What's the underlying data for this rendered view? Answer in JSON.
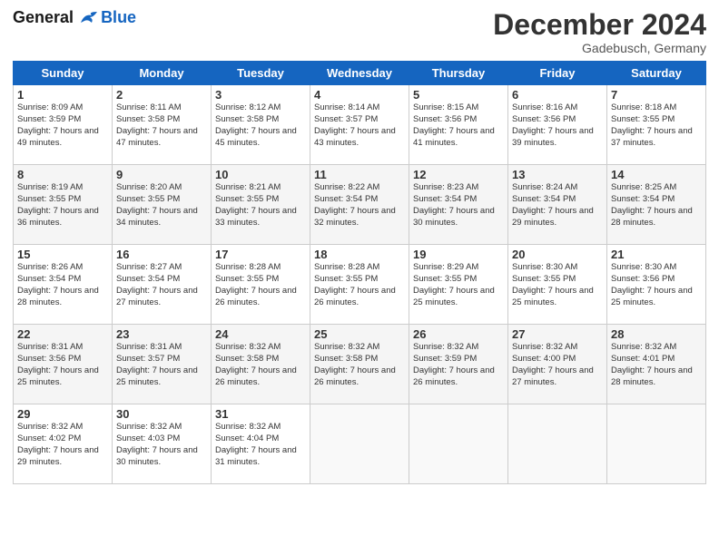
{
  "header": {
    "logo_line1": "General",
    "logo_line2": "Blue",
    "month": "December 2024",
    "location": "Gadebusch, Germany"
  },
  "days_of_week": [
    "Sunday",
    "Monday",
    "Tuesday",
    "Wednesday",
    "Thursday",
    "Friday",
    "Saturday"
  ],
  "weeks": [
    [
      {
        "day": "1",
        "rise": "8:09 AM",
        "set": "3:59 PM",
        "daylight": "7 hours and 49 minutes."
      },
      {
        "day": "2",
        "rise": "8:11 AM",
        "set": "3:58 PM",
        "daylight": "7 hours and 47 minutes."
      },
      {
        "day": "3",
        "rise": "8:12 AM",
        "set": "3:58 PM",
        "daylight": "7 hours and 45 minutes."
      },
      {
        "day": "4",
        "rise": "8:14 AM",
        "set": "3:57 PM",
        "daylight": "7 hours and 43 minutes."
      },
      {
        "day": "5",
        "rise": "8:15 AM",
        "set": "3:56 PM",
        "daylight": "7 hours and 41 minutes."
      },
      {
        "day": "6",
        "rise": "8:16 AM",
        "set": "3:56 PM",
        "daylight": "7 hours and 39 minutes."
      },
      {
        "day": "7",
        "rise": "8:18 AM",
        "set": "3:55 PM",
        "daylight": "7 hours and 37 minutes."
      }
    ],
    [
      {
        "day": "8",
        "rise": "8:19 AM",
        "set": "3:55 PM",
        "daylight": "7 hours and 36 minutes."
      },
      {
        "day": "9",
        "rise": "8:20 AM",
        "set": "3:55 PM",
        "daylight": "7 hours and 34 minutes."
      },
      {
        "day": "10",
        "rise": "8:21 AM",
        "set": "3:55 PM",
        "daylight": "7 hours and 33 minutes."
      },
      {
        "day": "11",
        "rise": "8:22 AM",
        "set": "3:54 PM",
        "daylight": "7 hours and 32 minutes."
      },
      {
        "day": "12",
        "rise": "8:23 AM",
        "set": "3:54 PM",
        "daylight": "7 hours and 30 minutes."
      },
      {
        "day": "13",
        "rise": "8:24 AM",
        "set": "3:54 PM",
        "daylight": "7 hours and 29 minutes."
      },
      {
        "day": "14",
        "rise": "8:25 AM",
        "set": "3:54 PM",
        "daylight": "7 hours and 28 minutes."
      }
    ],
    [
      {
        "day": "15",
        "rise": "8:26 AM",
        "set": "3:54 PM",
        "daylight": "7 hours and 28 minutes."
      },
      {
        "day": "16",
        "rise": "8:27 AM",
        "set": "3:54 PM",
        "daylight": "7 hours and 27 minutes."
      },
      {
        "day": "17",
        "rise": "8:28 AM",
        "set": "3:55 PM",
        "daylight": "7 hours and 26 minutes."
      },
      {
        "day": "18",
        "rise": "8:28 AM",
        "set": "3:55 PM",
        "daylight": "7 hours and 26 minutes."
      },
      {
        "day": "19",
        "rise": "8:29 AM",
        "set": "3:55 PM",
        "daylight": "7 hours and 25 minutes."
      },
      {
        "day": "20",
        "rise": "8:30 AM",
        "set": "3:55 PM",
        "daylight": "7 hours and 25 minutes."
      },
      {
        "day": "21",
        "rise": "8:30 AM",
        "set": "3:56 PM",
        "daylight": "7 hours and 25 minutes."
      }
    ],
    [
      {
        "day": "22",
        "rise": "8:31 AM",
        "set": "3:56 PM",
        "daylight": "7 hours and 25 minutes."
      },
      {
        "day": "23",
        "rise": "8:31 AM",
        "set": "3:57 PM",
        "daylight": "7 hours and 25 minutes."
      },
      {
        "day": "24",
        "rise": "8:32 AM",
        "set": "3:58 PM",
        "daylight": "7 hours and 26 minutes."
      },
      {
        "day": "25",
        "rise": "8:32 AM",
        "set": "3:58 PM",
        "daylight": "7 hours and 26 minutes."
      },
      {
        "day": "26",
        "rise": "8:32 AM",
        "set": "3:59 PM",
        "daylight": "7 hours and 26 minutes."
      },
      {
        "day": "27",
        "rise": "8:32 AM",
        "set": "4:00 PM",
        "daylight": "7 hours and 27 minutes."
      },
      {
        "day": "28",
        "rise": "8:32 AM",
        "set": "4:01 PM",
        "daylight": "7 hours and 28 minutes."
      }
    ],
    [
      {
        "day": "29",
        "rise": "8:32 AM",
        "set": "4:02 PM",
        "daylight": "7 hours and 29 minutes."
      },
      {
        "day": "30",
        "rise": "8:32 AM",
        "set": "4:03 PM",
        "daylight": "7 hours and 30 minutes."
      },
      {
        "day": "31",
        "rise": "8:32 AM",
        "set": "4:04 PM",
        "daylight": "7 hours and 31 minutes."
      },
      null,
      null,
      null,
      null
    ]
  ]
}
